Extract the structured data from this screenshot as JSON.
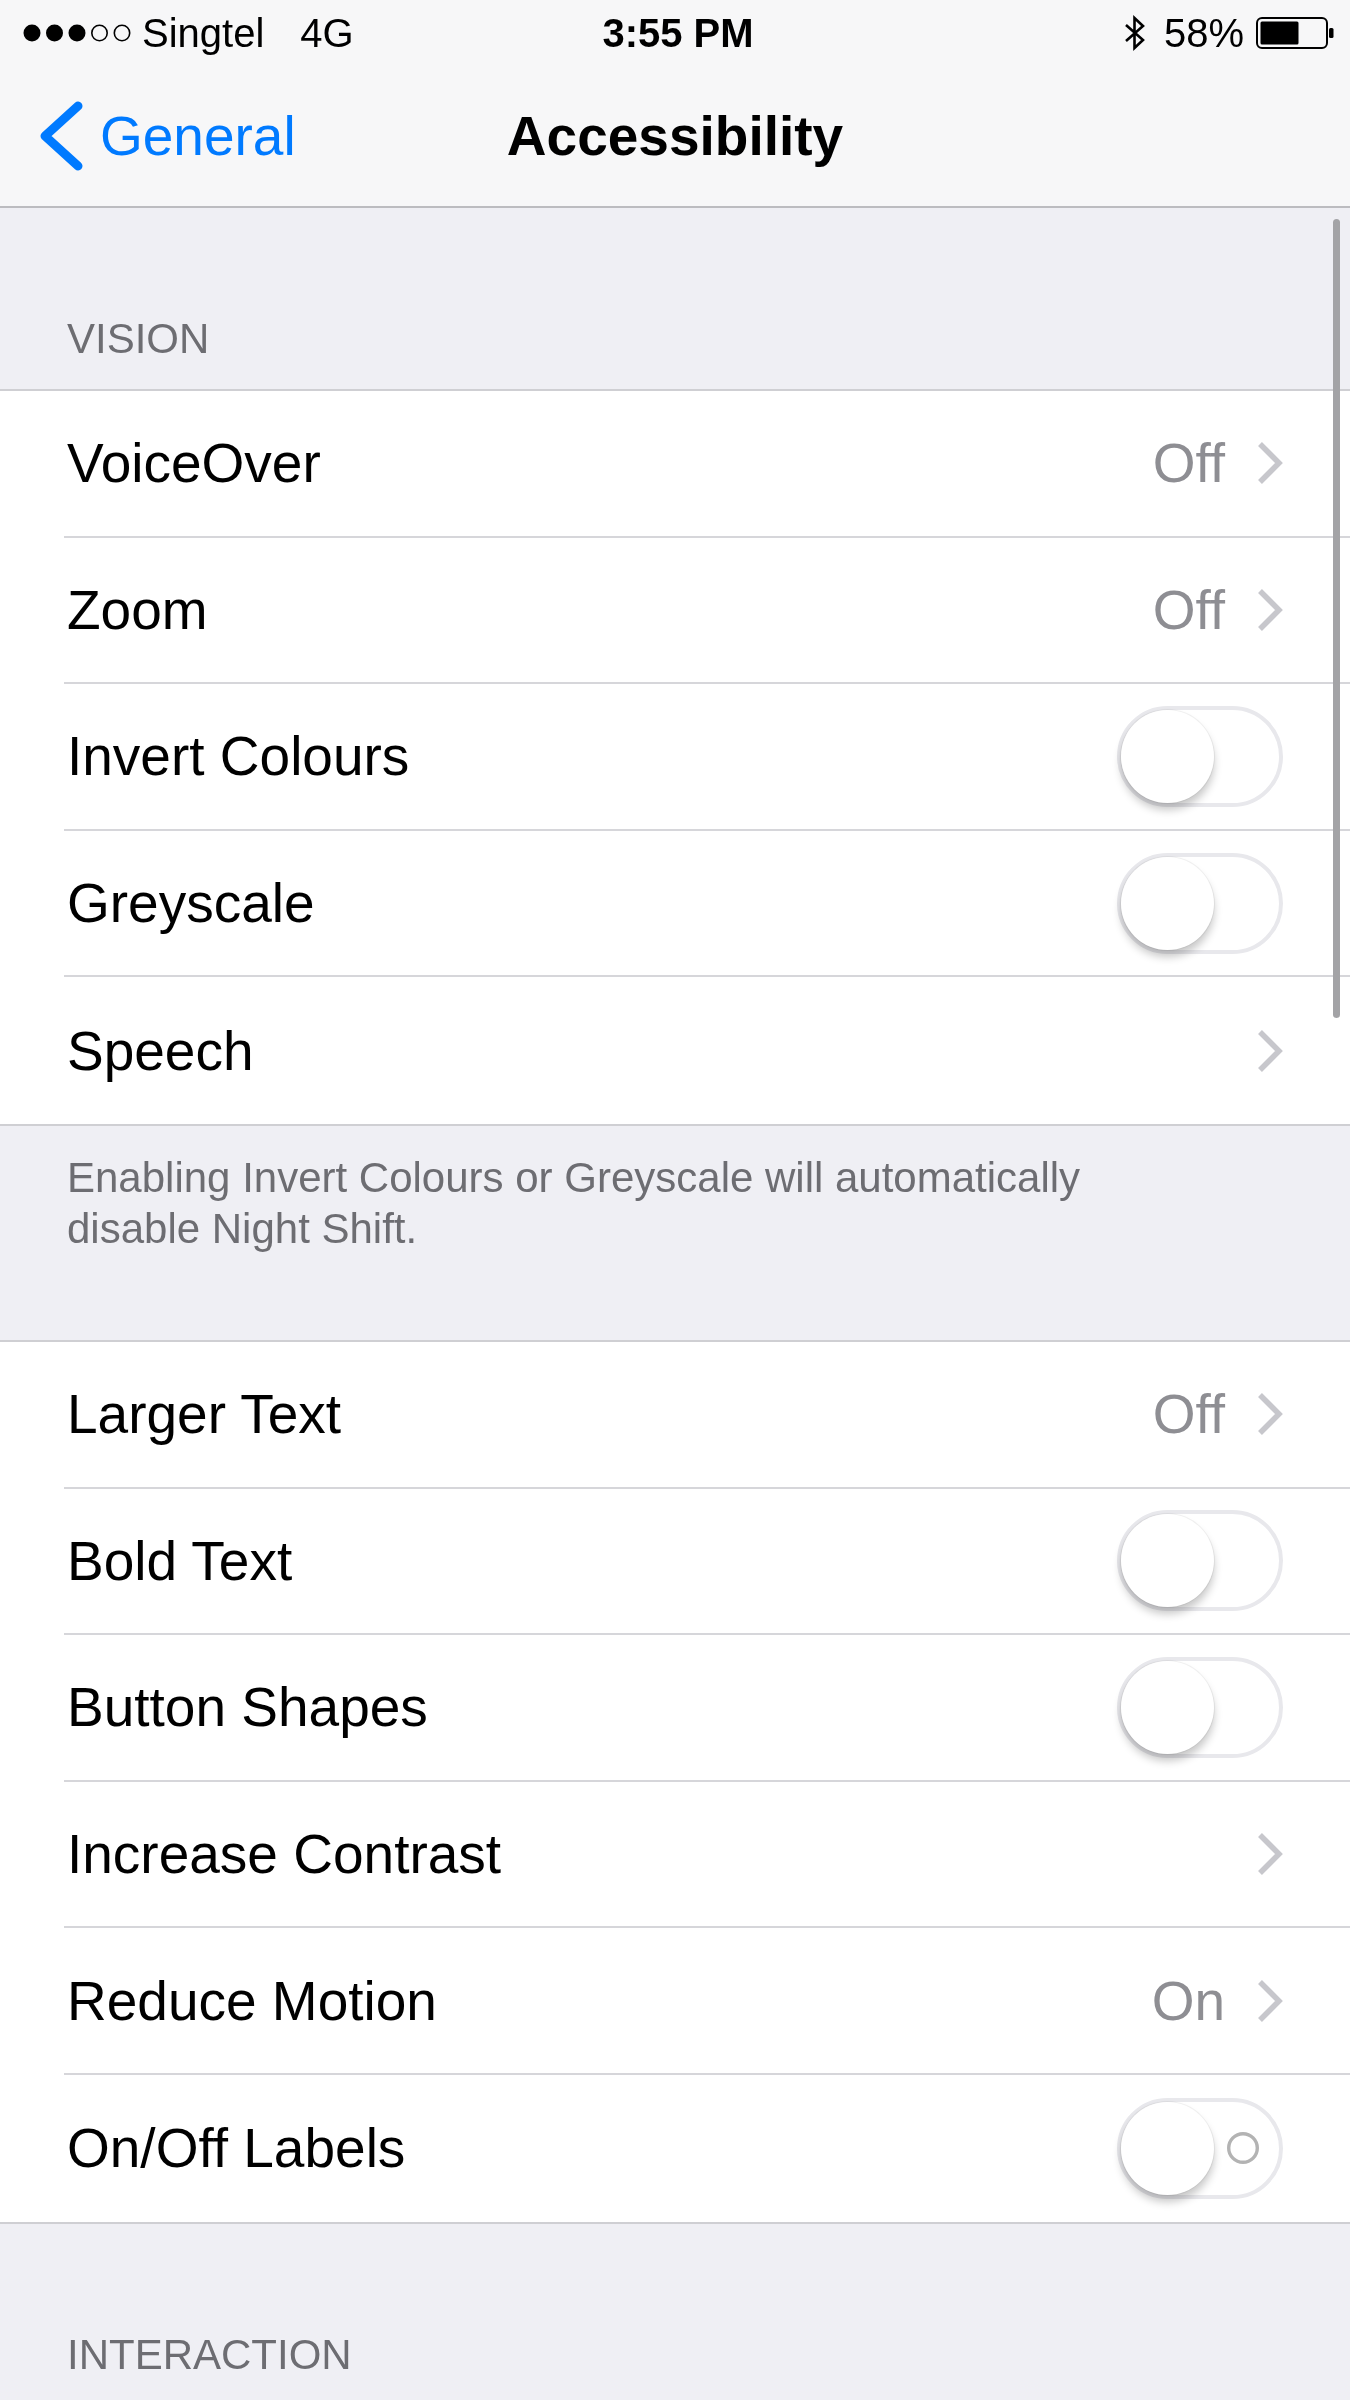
{
  "status_bar": {
    "carrier": "Singtel",
    "network": "4G",
    "time": "3:55 PM",
    "battery": "58%"
  },
  "nav_bar": {
    "back": "General",
    "title": "Accessibility"
  },
  "sections": [
    {
      "header": "VISION",
      "items": [
        {
          "kind": "disclosure",
          "label": "VoiceOver",
          "value": "Off"
        },
        {
          "kind": "disclosure",
          "label": "Zoom",
          "value": "Off"
        },
        {
          "kind": "toggle",
          "label": "Invert Colours",
          "on": false,
          "labels": false
        },
        {
          "kind": "toggle",
          "label": "Greyscale",
          "on": false,
          "labels": false
        },
        {
          "kind": "disclosure",
          "label": "Speech"
        }
      ],
      "footer": "Enabling Invert Colours or Greyscale will automatically disable Night Shift."
    },
    {
      "items": [
        {
          "kind": "disclosure",
          "label": "Larger Text",
          "value": "Off"
        },
        {
          "kind": "toggle",
          "label": "Bold Text",
          "on": false,
          "labels": false
        },
        {
          "kind": "toggle",
          "label": "Button Shapes",
          "on": false,
          "labels": false
        },
        {
          "kind": "disclosure",
          "label": "Increase Contrast"
        },
        {
          "kind": "disclosure",
          "label": "Reduce Motion",
          "value": "On"
        },
        {
          "kind": "toggle",
          "label": "On/Off Labels",
          "on": false,
          "labels": true
        }
      ]
    },
    {
      "header": "INTERACTION"
    }
  ]
}
